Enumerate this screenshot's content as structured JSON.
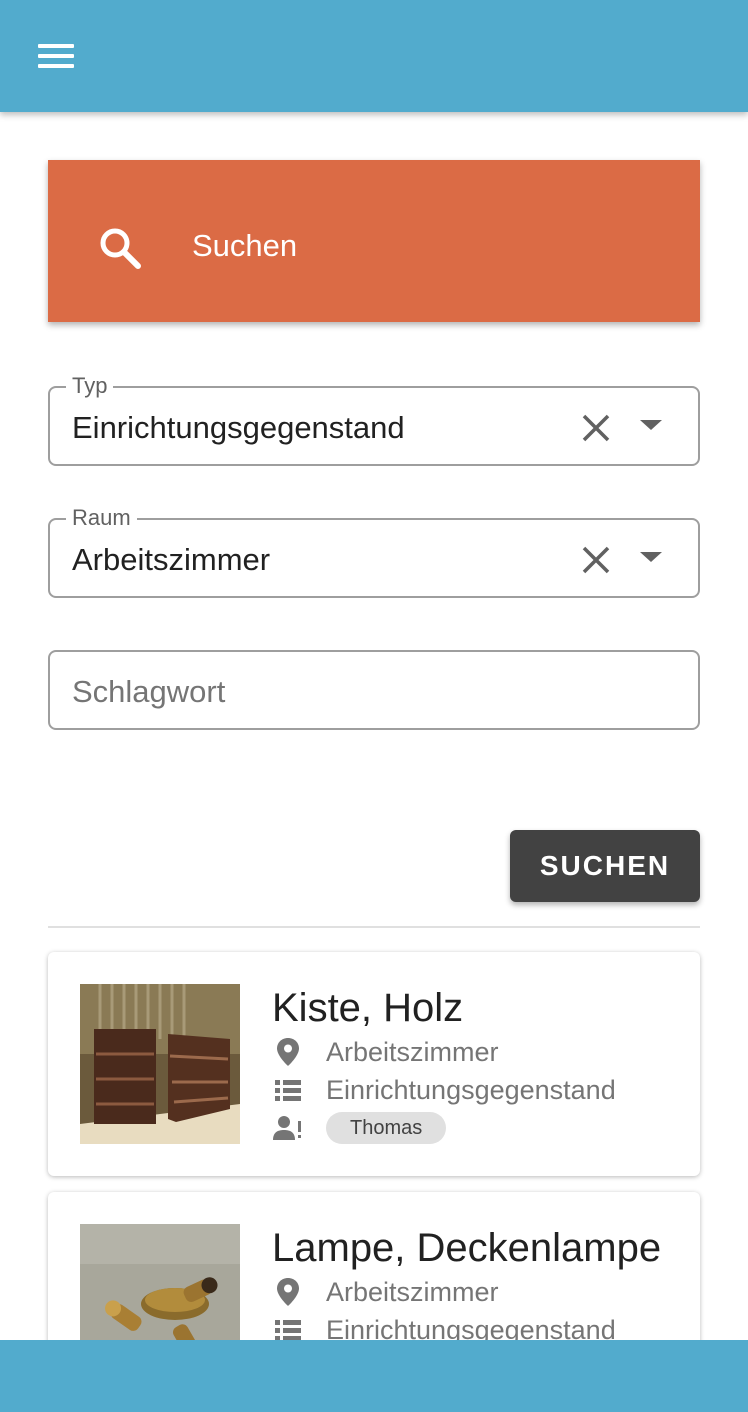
{
  "header": {
    "menu_icon": "menu-icon"
  },
  "hero": {
    "icon": "search-icon",
    "title": "Suchen"
  },
  "filters": {
    "type": {
      "label": "Typ",
      "value": "Einrichtungsgegenstand"
    },
    "room": {
      "label": "Raum",
      "value": "Arbeitszimmer"
    },
    "keyword": {
      "placeholder": "Schlagwort",
      "value": ""
    }
  },
  "search_button_label": "SUCHEN",
  "results": [
    {
      "title": "Kiste, Holz",
      "room": "Arbeitszimmer",
      "type": "Einrichtungsgegenstand",
      "owner": "Thomas"
    },
    {
      "title": "Lampe, Deckenlampe",
      "room": "Arbeitszimmer",
      "type": "Einrichtungsgegenstand"
    }
  ],
  "colors": {
    "appbar": "#52abcd",
    "hero": "#db6b45",
    "button": "#424242"
  }
}
